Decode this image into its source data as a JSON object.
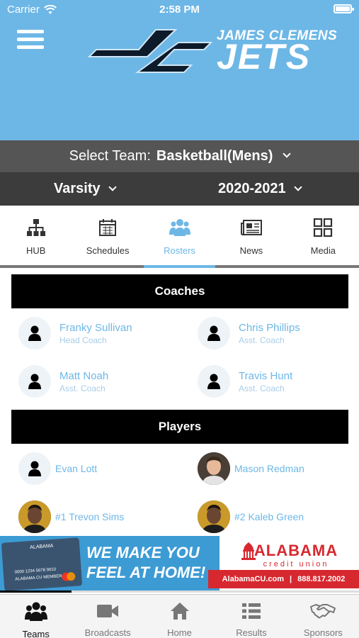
{
  "status_bar": {
    "carrier": "Carrier",
    "time": "2:58 PM",
    "battery_level": 1.0
  },
  "header": {
    "school_name": "JAMES CLEMENS",
    "team_name": "JETS",
    "bg_color": "#6db7e6"
  },
  "team_selector": {
    "label": "Select Team:",
    "value": "Basketball(Mens)"
  },
  "level_selector": {
    "value": "Varsity"
  },
  "season_selector": {
    "value": "2020-2021"
  },
  "tabs": [
    {
      "label": "HUB",
      "icon": "hierarchy-icon",
      "active": false
    },
    {
      "label": "Schedules",
      "icon": "calendar-icon",
      "active": false
    },
    {
      "label": "Rosters",
      "icon": "users-icon",
      "active": true
    },
    {
      "label": "News",
      "icon": "newspaper-icon",
      "active": false
    },
    {
      "label": "Media",
      "icon": "grid-icon",
      "active": false
    }
  ],
  "coaches": {
    "title": "Coaches",
    "items": [
      {
        "name": "Franky Sullivan",
        "role": "Head Coach"
      },
      {
        "name": "Chris Phillips",
        "role": "Asst. Coach"
      },
      {
        "name": "Matt Noah",
        "role": "Asst. Coach"
      },
      {
        "name": "Travis Hunt",
        "role": "Asst. Coach"
      }
    ]
  },
  "players": {
    "title": "Players",
    "items": [
      {
        "name": "Evan Lott",
        "photo": false
      },
      {
        "name": "Mason Redman",
        "photo": true
      },
      {
        "name": "#1 Trevon Sims",
        "photo": true
      },
      {
        "name": "#2 Kaleb Green",
        "photo": true
      }
    ]
  },
  "ad": {
    "slogan_line1": "WE MAKE YOU",
    "slogan_line2": "FEEL AT HOME!",
    "brand_name": "ALABAMA",
    "brand_sub": "credit union",
    "website": "AlabamaCU.com",
    "separator": "|",
    "phone": "888.817.2002",
    "card_bank": "ALABAMA",
    "card_number": "0000 1234 5678 9010",
    "card_holder": "ALABAMA CU MEMBER",
    "progress": 0.2
  },
  "bottom_nav": [
    {
      "label": "Teams",
      "icon": "people-icon",
      "active": true
    },
    {
      "label": "Broadcasts",
      "icon": "video-camera-icon",
      "active": false
    },
    {
      "label": "Home",
      "icon": "home-icon",
      "active": false
    },
    {
      "label": "Results",
      "icon": "list-icon",
      "active": false
    },
    {
      "label": "Sponsors",
      "icon": "handshake-icon",
      "active": false
    }
  ],
  "colors": {
    "accent": "#6db7e6",
    "dark_bar": "#3c3c3c",
    "mid_bar": "#555555",
    "ad_red": "#d7282f"
  }
}
